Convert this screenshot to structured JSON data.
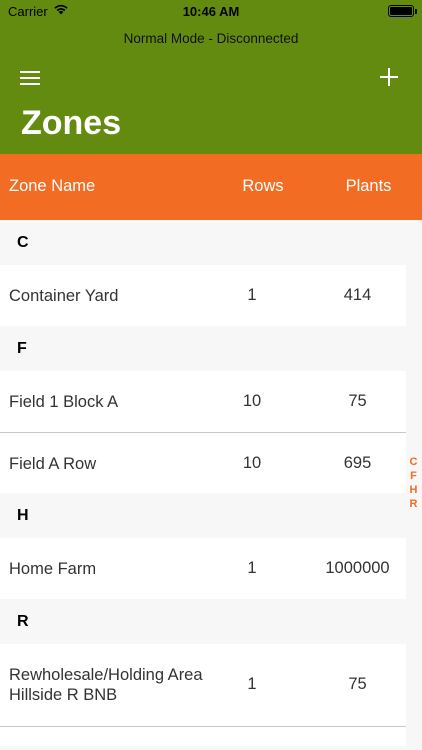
{
  "statusbar": {
    "carrier": "Carrier",
    "time": "10:46 AM"
  },
  "connection_mode": "Normal Mode - Disconnected",
  "page_title": "Zones",
  "columns": {
    "name": "Zone Name",
    "rows": "Rows",
    "plants": "Plants"
  },
  "sections": [
    {
      "letter": "C",
      "zones": [
        {
          "name": "Container Yard",
          "rows": "1",
          "plants": "414"
        }
      ]
    },
    {
      "letter": "F",
      "zones": [
        {
          "name": "Field 1 Block A",
          "rows": "10",
          "plants": "75"
        },
        {
          "name": "Field A Row",
          "rows": "10",
          "plants": "695"
        }
      ]
    },
    {
      "letter": "H",
      "zones": [
        {
          "name": "Home Farm",
          "rows": "1",
          "plants": "1000000"
        }
      ]
    },
    {
      "letter": "R",
      "zones": [
        {
          "name": "Rewholesale/Holding Area Hillside R BNB",
          "rows": "1",
          "plants": "75"
        }
      ]
    }
  ],
  "section_index": [
    "C",
    "F",
    "H",
    "R"
  ],
  "colors": {
    "header": "#638b10",
    "accent": "#f26c23"
  },
  "icons": {
    "menu": "menu-icon",
    "add": "plus-icon",
    "wifi": "wifi-icon",
    "battery": "battery-icon"
  }
}
